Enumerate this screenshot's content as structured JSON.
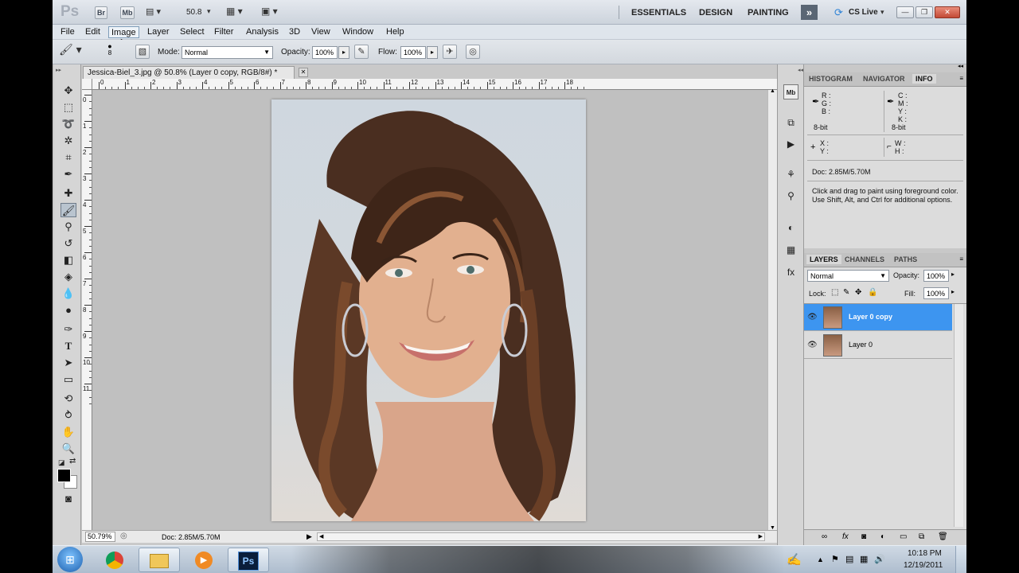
{
  "appbar": {
    "logo": "Ps",
    "bridge_btn": "Br",
    "minibridge_btn": "Mb",
    "zoom": "50.8",
    "workspaces": [
      "ESSENTIALS",
      "DESIGN",
      "PAINTING"
    ],
    "more_icon": "double-chevron-icon",
    "cs_live": "CS Live"
  },
  "menu": {
    "items": [
      "File",
      "Edit",
      "Image",
      "Layer",
      "Select",
      "Filter",
      "Analysis",
      "3D",
      "View",
      "Window",
      "Help"
    ],
    "active": "Image"
  },
  "options": {
    "brush_size": "8",
    "mode_label": "Mode:",
    "mode_value": "Normal",
    "opacity_label": "Opacity:",
    "opacity_value": "100%",
    "flow_label": "Flow:",
    "flow_value": "100%"
  },
  "document": {
    "tab_title": "Jessica-Biel_3.jpg @ 50.8% (Layer 0 copy, RGB/8#) *",
    "h_ruler_labels": [
      "0",
      "1",
      "2",
      "3",
      "4",
      "5",
      "6",
      "7",
      "8",
      "9",
      "10",
      "11",
      "12",
      "13",
      "14",
      "15",
      "16",
      "17",
      "18"
    ],
    "v_ruler_labels": [
      "0",
      "1",
      "2",
      "3",
      "4",
      "5",
      "6",
      "7",
      "8",
      "9",
      "10",
      "11"
    ],
    "zoom_status": "50.79%",
    "doc_status": "Doc: 2.85M/5.70M"
  },
  "info_panel": {
    "tabs": [
      "HISTOGRAM",
      "NAVIGATOR",
      "INFO"
    ],
    "active_tab": "INFO",
    "rgb_labels": [
      "R :",
      "G :",
      "B :"
    ],
    "cmyk_labels": [
      "C :",
      "M :",
      "Y :",
      "K :"
    ],
    "bit_left": "8-bit",
    "bit_right": "8-bit",
    "xy_labels": [
      "X :",
      "Y :"
    ],
    "wh_labels": [
      "W :",
      "H :"
    ],
    "doc": "Doc: 2.85M/5.70M",
    "hint": "Click and drag to paint using foreground color.  Use Shift, Alt, and Ctrl for additional options."
  },
  "layers_panel": {
    "tabs": [
      "LAYERS",
      "CHANNELS",
      "PATHS"
    ],
    "active_tab": "LAYERS",
    "blend_mode": "Normal",
    "opacity_label": "Opacity:",
    "opacity_value": "100%",
    "lock_label": "Lock:",
    "fill_label": "Fill:",
    "fill_value": "100%",
    "layers": [
      {
        "name": "Layer 0 copy",
        "selected": true
      },
      {
        "name": "Layer 0",
        "selected": false
      }
    ]
  },
  "taskbar": {
    "time": "10:18 PM",
    "date": "12/19/2011"
  },
  "colors": {
    "accent_selection": "#3d95f0",
    "taskbar": "#b9c7d8"
  }
}
